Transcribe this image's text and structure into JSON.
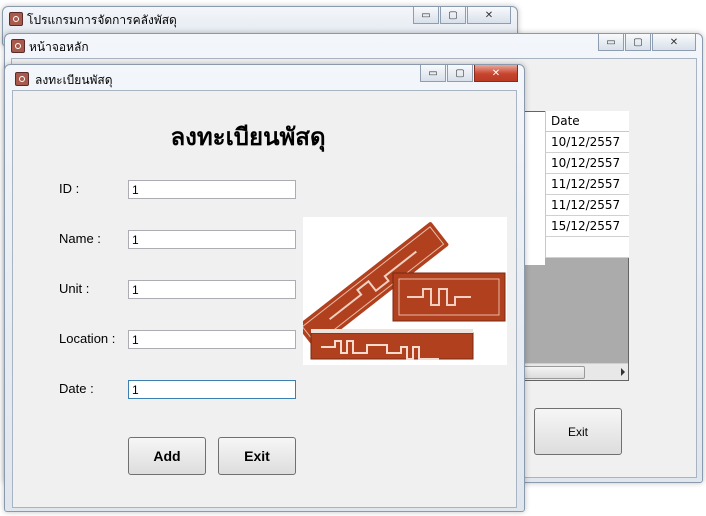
{
  "windows": {
    "back": {
      "title": "โปรแกรมการจัดการคลังพัสดุ"
    },
    "main": {
      "title": "หน้าจอหลัก",
      "grid": {
        "header": "Date",
        "rows": [
          "10/12/2557",
          "10/12/2557",
          "11/12/2557",
          "11/12/2557",
          "15/12/2557",
          ""
        ]
      },
      "exit_label": "Exit"
    },
    "form": {
      "title": "ลงทะเบียนพัสดุ",
      "heading": "ลงทะเบียนพัสดุ",
      "fields": [
        {
          "label": "ID :",
          "value": "1"
        },
        {
          "label": "Name :",
          "value": "1"
        },
        {
          "label": "Unit :",
          "value": "1"
        },
        {
          "label": "Location :",
          "value": "1"
        },
        {
          "label": "Date :",
          "value": "1"
        }
      ],
      "add_label": "Add",
      "exit_label": "Exit"
    }
  },
  "caption_buttons": {
    "minimize": "▭",
    "maximize": "▢",
    "close": "✕"
  },
  "colors": {
    "rfid_tag": "#b0401e",
    "close_red": "#c7442e"
  }
}
